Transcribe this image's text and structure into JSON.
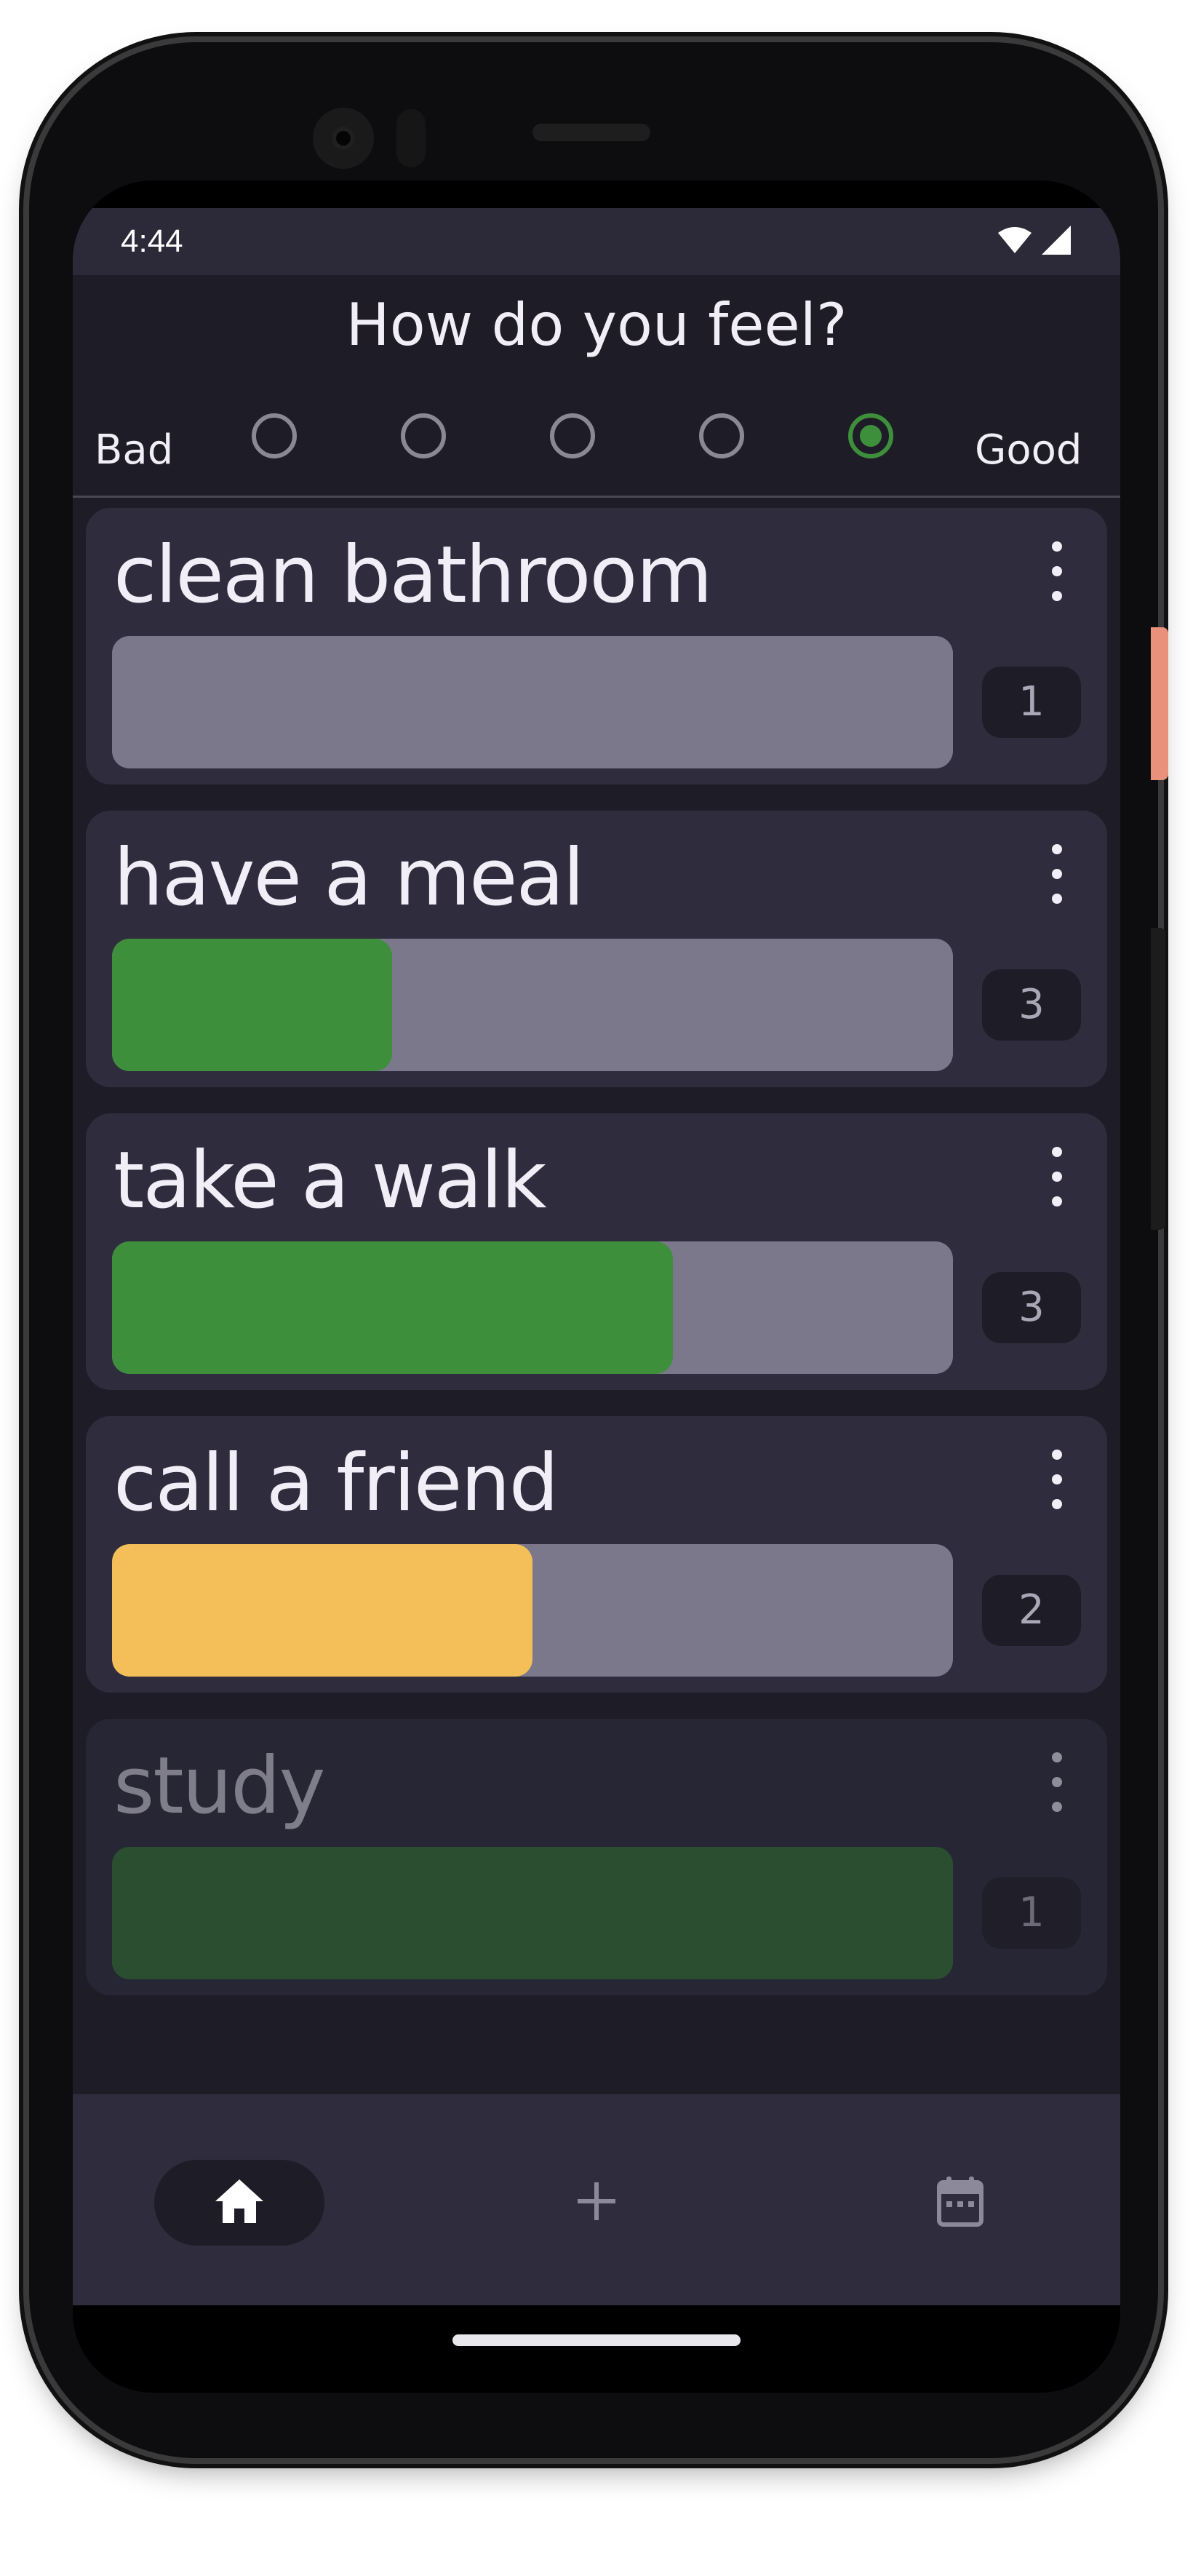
{
  "status_bar": {
    "time": "4:44"
  },
  "header": {
    "title": "How do you feel?"
  },
  "mood": {
    "bad_label": "Bad",
    "good_label": "Good",
    "options_count": 5,
    "selected_index": 4
  },
  "tasks": [
    {
      "title": "clean bathroom",
      "count": "1",
      "progress": 0.0,
      "color": "#3e8f3c",
      "dimmed": false
    },
    {
      "title": "have a meal",
      "count": "3",
      "progress": 0.333,
      "color": "#3e8f3c",
      "dimmed": false
    },
    {
      "title": "take a walk",
      "count": "3",
      "progress": 0.667,
      "color": "#3e8f3c",
      "dimmed": false
    },
    {
      "title": "call a friend",
      "count": "2",
      "progress": 0.5,
      "color": "#f4bf59",
      "dimmed": false
    },
    {
      "title": "study",
      "count": "1",
      "progress": 1.0,
      "color": "#2a4e2f",
      "dimmed": true
    }
  ],
  "nav": {
    "items": [
      {
        "name": "home",
        "icon": "home-icon",
        "selected": true
      },
      {
        "name": "add",
        "icon": "plus-icon",
        "selected": false
      },
      {
        "name": "calendar",
        "icon": "calendar-icon",
        "selected": false
      }
    ]
  },
  "colors": {
    "background": "#1e1d27",
    "card": "#2f2d3d",
    "track": "#7b788c",
    "accent_green": "#3e8f3c",
    "accent_yellow": "#f4bf59"
  }
}
